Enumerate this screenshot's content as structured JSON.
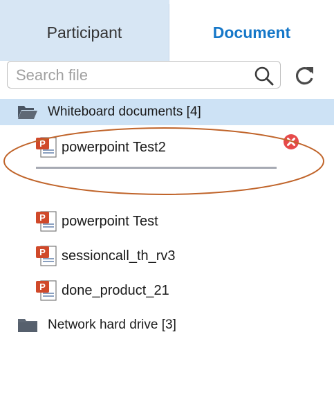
{
  "tabs": {
    "participant": "Participant",
    "document": "Document"
  },
  "search": {
    "placeholder": "Search file",
    "value": ""
  },
  "folders": [
    {
      "label": "Whiteboard documents [4]",
      "icon": "folder-open-icon",
      "selected": true
    },
    {
      "label": "Network hard drive [3]",
      "icon": "folder-closed-icon",
      "selected": false
    }
  ],
  "uploading": {
    "label": "powerpoint Test2",
    "icon": "powerpoint-file-icon"
  },
  "files": [
    {
      "label": "powerpoint Test",
      "icon": "powerpoint-file-icon"
    },
    {
      "label": "sessioncall_th_rv3",
      "icon": "powerpoint-file-icon"
    },
    {
      "label": "done_product_21",
      "icon": "powerpoint-file-icon"
    }
  ],
  "colors": {
    "tab_active_text": "#1577c8",
    "tab_inactive_bg": "#d7e6f4",
    "selected_row_bg": "#cde2f5",
    "delete_red": "#e64a4a",
    "annotation_ellipse": "#c0642a"
  }
}
